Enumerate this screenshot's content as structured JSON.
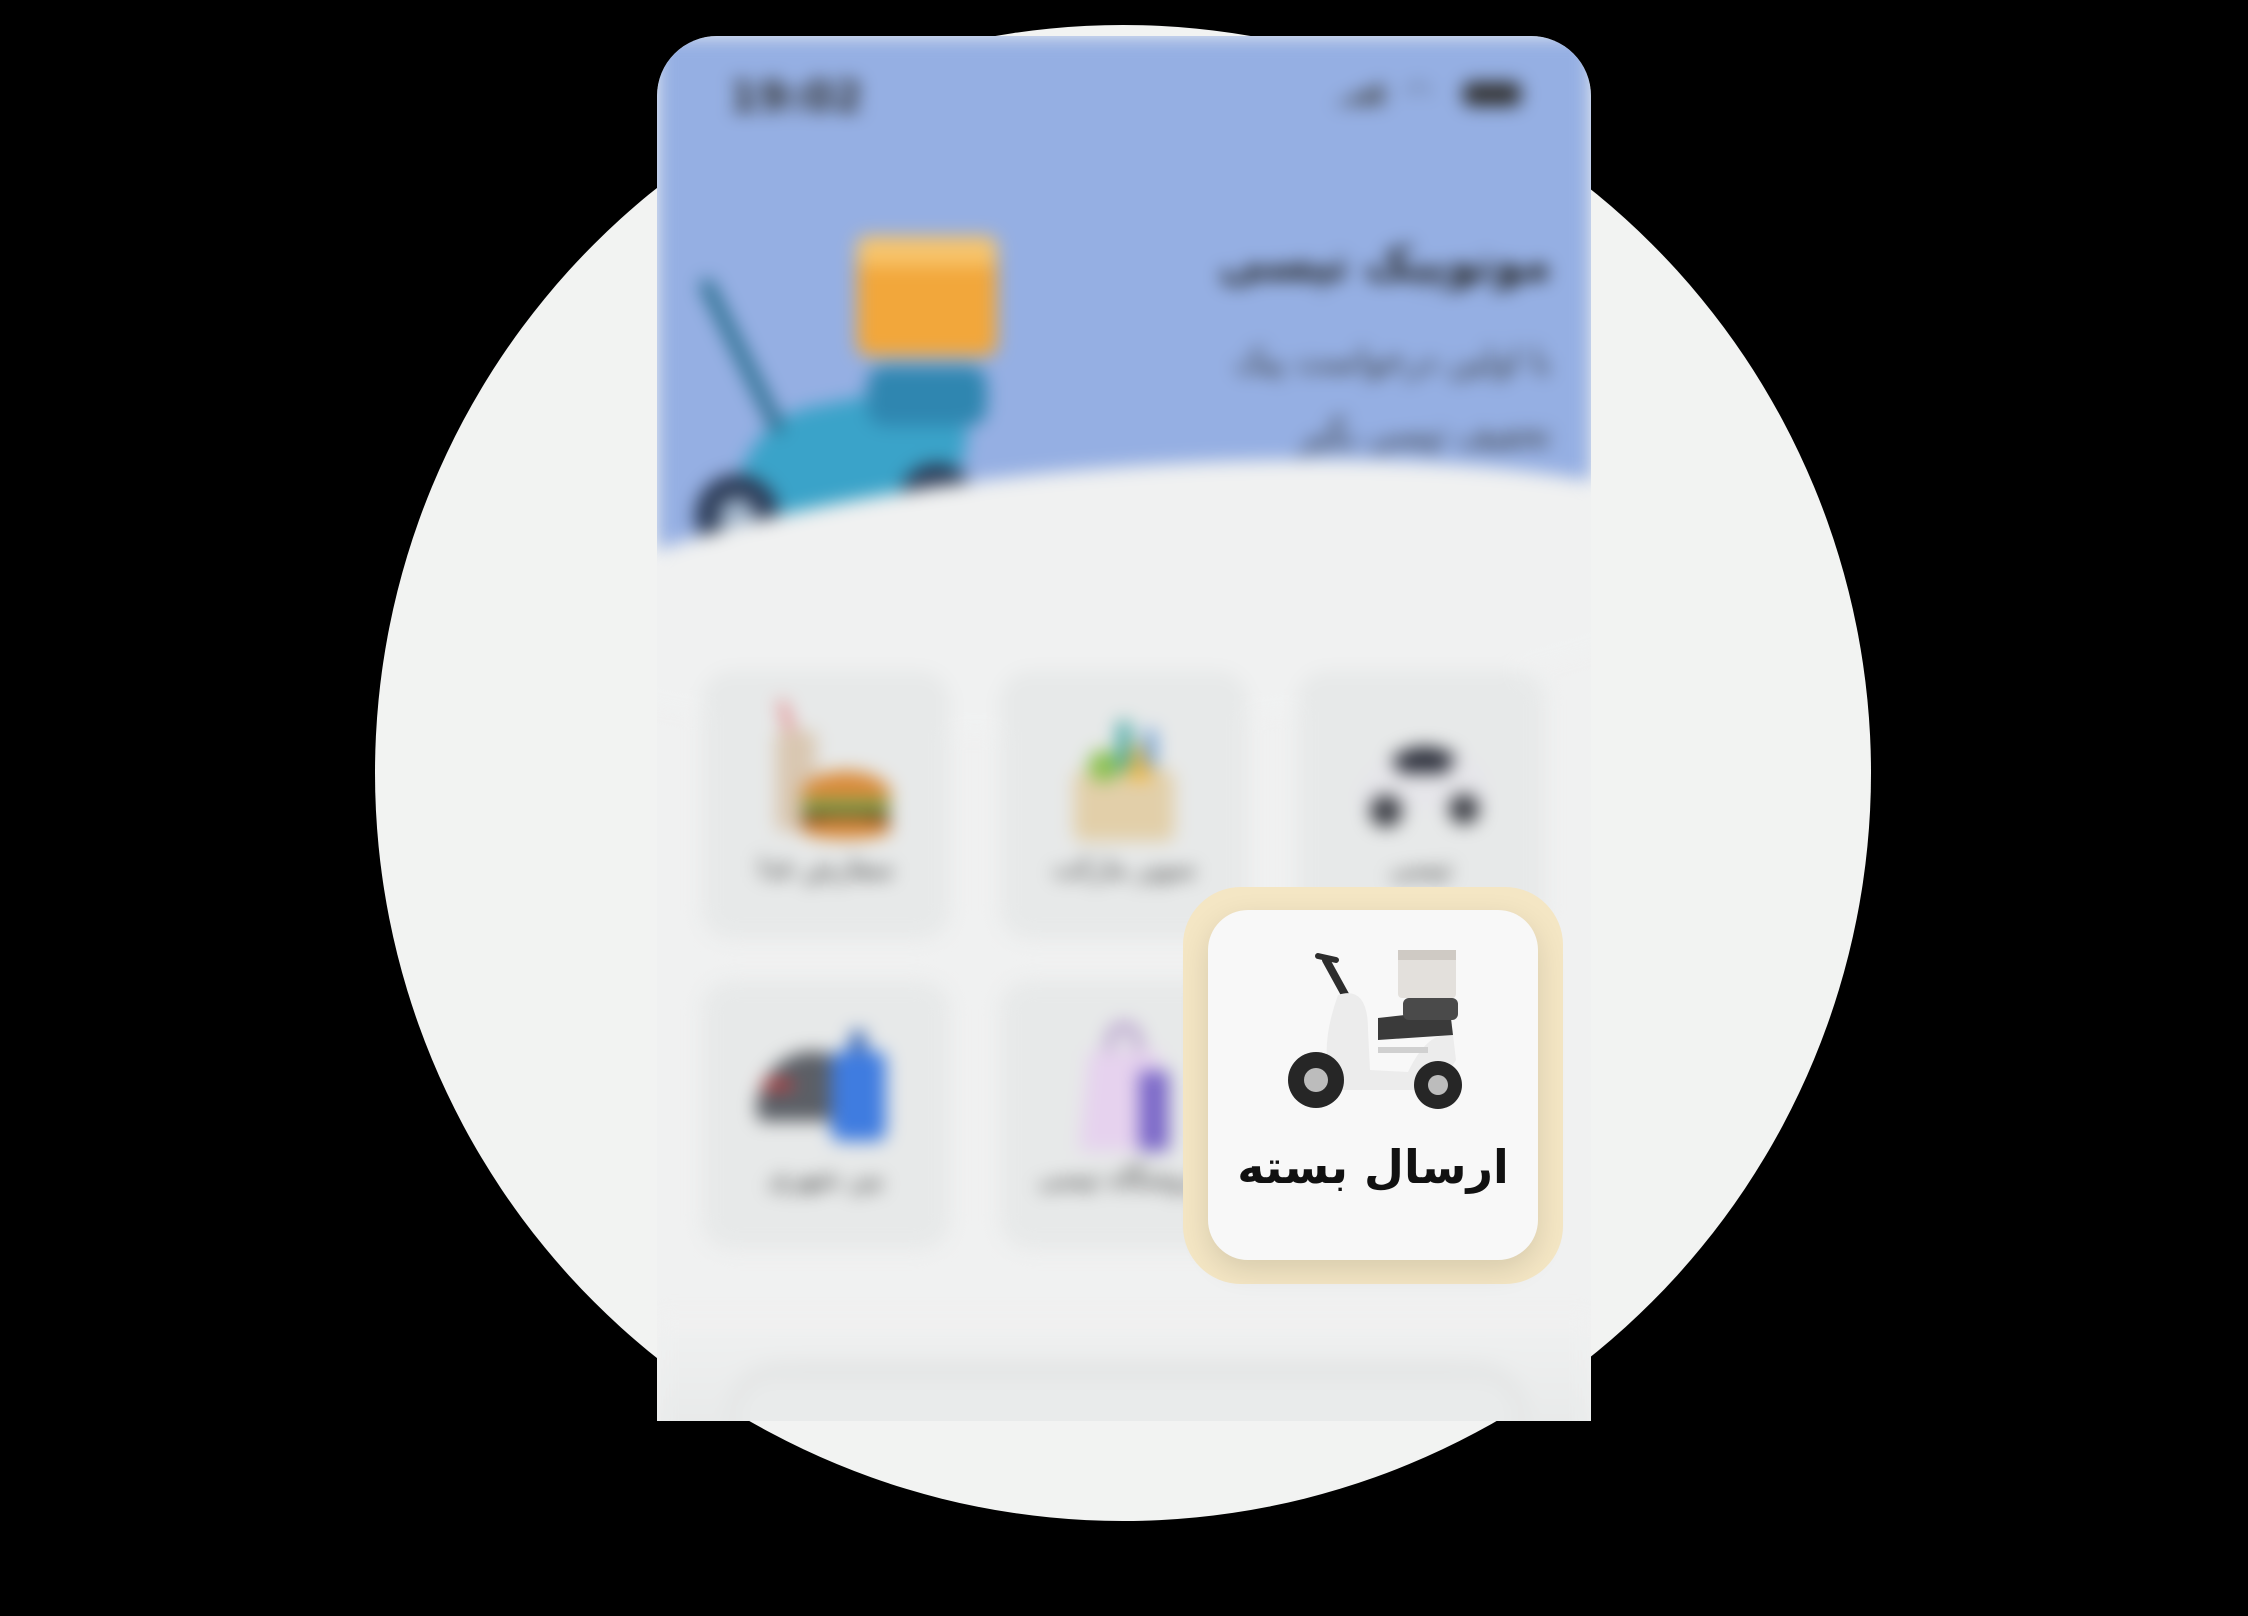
{
  "status_bar": {
    "time": "19:02",
    "icons": [
      "signal-icon",
      "wifi-icon",
      "battery-icon"
    ]
  },
  "hero": {
    "title": "موتوپیک تپسی",
    "subtitle_line1": "با اولین درخواست پیک",
    "subtitle_line2": "تخفیف تپسی بگیر",
    "image": "scooter-with-package-icon"
  },
  "services": [
    {
      "label": "تپسی",
      "icon": "car-icon"
    },
    {
      "label": "سوپر مارکت",
      "icon": "grocery-basket-icon"
    },
    {
      "label": "سفارش غذا",
      "icon": "burger-drink-icon"
    },
    {
      "label": "",
      "icon": "delivery-scooter-icon"
    },
    {
      "label": "فروشگاه تپسی",
      "icon": "shopping-bag-icon"
    },
    {
      "label": "بین شهری",
      "icon": "car-luggage-icon"
    }
  ],
  "highlight_card": {
    "label": "ارسال بسته",
    "icon": "delivery-scooter-icon"
  },
  "colors": {
    "hero": "#95afe3",
    "highlight_border": "#f4e6c4",
    "background": "#f2f3f2"
  }
}
